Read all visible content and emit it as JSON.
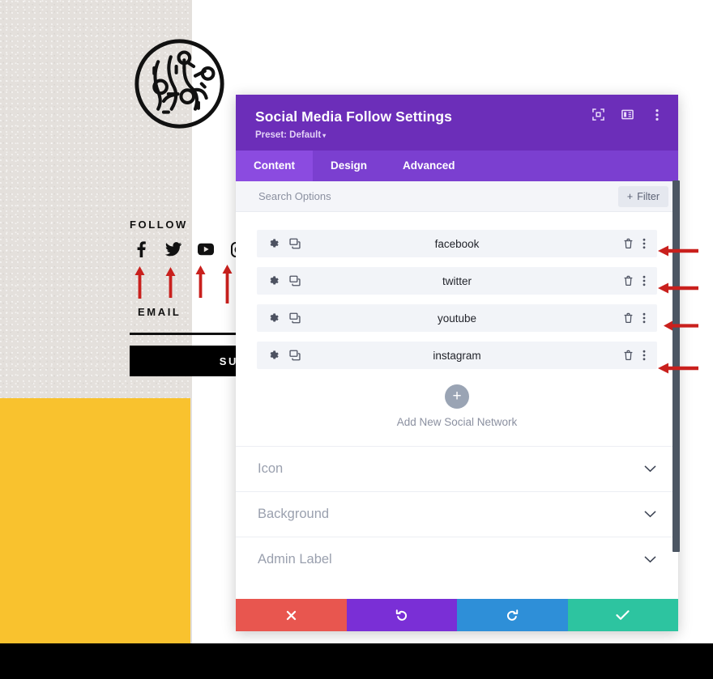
{
  "colors": {
    "purple_header": "#6c2eb9",
    "purple_tabs": "#7b3fd0",
    "purple_tab_active": "#8b4be0",
    "yellow_block": "#f9c22e",
    "page_bg": "#e4e0dc",
    "cancel_red": "#e8564f",
    "undo_purple": "#7a2fd6",
    "redo_blue": "#2e8fd8",
    "save_green": "#2dc4a0",
    "arrow_red": "#c9201d",
    "scrollbar": "#4c5663"
  },
  "website": {
    "logo_name": "circuit-circle-logo",
    "follow_heading": "FOLLOW",
    "social_icons": [
      {
        "name": "facebook-icon",
        "label": "facebook"
      },
      {
        "name": "twitter-icon",
        "label": "twitter"
      },
      {
        "name": "youtube-icon",
        "label": "youtube"
      },
      {
        "name": "instagram-icon",
        "label": "instagram"
      }
    ],
    "email_heading": "EMAIL",
    "email_value": "",
    "subscribe_label": "SUB"
  },
  "modal": {
    "title": "Social Media Follow Settings",
    "preset_label": "Preset: Default",
    "preset_caret": "▾",
    "header_icons": [
      {
        "name": "focus-target-icon"
      },
      {
        "name": "layout-panel-icon"
      },
      {
        "name": "vertical-dots-icon"
      }
    ],
    "tabs": [
      {
        "label": "Content",
        "active": true
      },
      {
        "label": "Design",
        "active": false
      },
      {
        "label": "Advanced",
        "active": false
      }
    ],
    "search": {
      "placeholder": "Search Options",
      "value": ""
    },
    "filter_label": "Filter",
    "filter_plus": "+",
    "social_items": [
      {
        "label": "facebook"
      },
      {
        "label": "twitter"
      },
      {
        "label": "youtube"
      },
      {
        "label": "instagram"
      }
    ],
    "row_icons": {
      "settings": "gear-icon",
      "duplicate": "duplicate-icon",
      "delete": "trash-icon",
      "more": "vertical-dots-icon"
    },
    "add_new": {
      "plus": "+",
      "label": "Add New Social Network"
    },
    "accordions": [
      {
        "label": "Icon"
      },
      {
        "label": "Background"
      },
      {
        "label": "Admin Label"
      }
    ],
    "footer_buttons": [
      {
        "name": "cancel-button",
        "icon": "close-x-icon"
      },
      {
        "name": "undo-button",
        "icon": "undo-arrow-icon"
      },
      {
        "name": "redo-button",
        "icon": "redo-arrow-icon"
      },
      {
        "name": "save-button",
        "icon": "check-icon"
      }
    ]
  },
  "annotations": {
    "up_arrows_count": 4,
    "side_arrows_count": 4,
    "description": "red annotation arrows"
  }
}
